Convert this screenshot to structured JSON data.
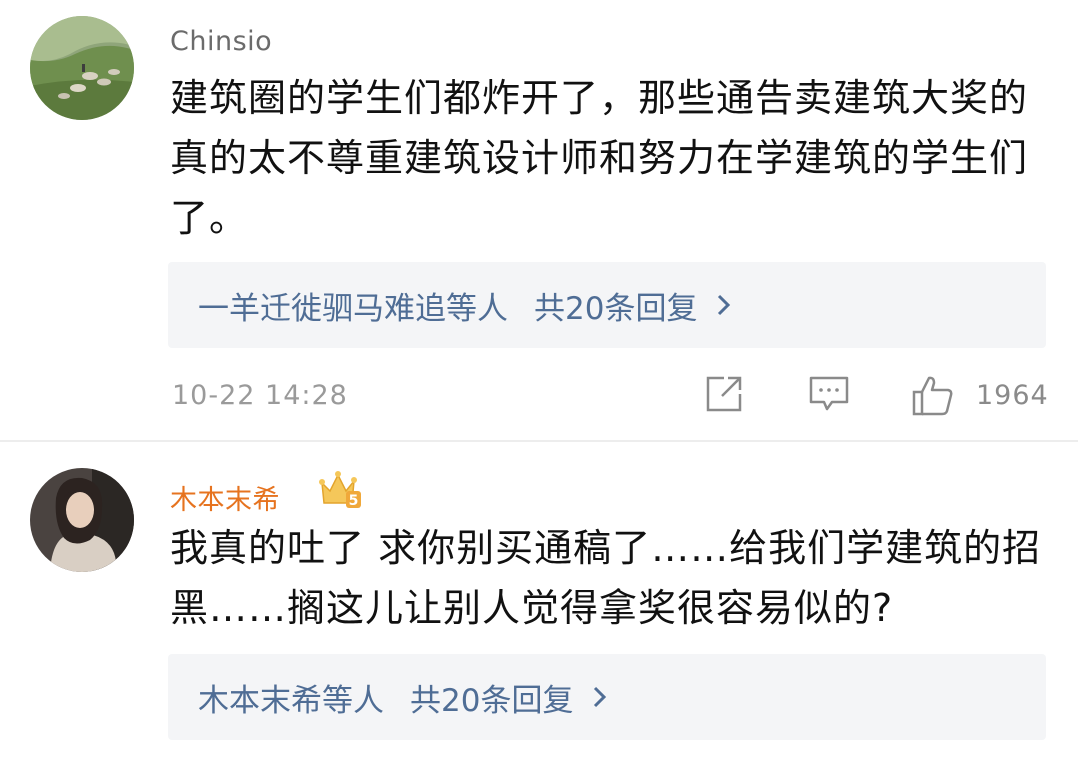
{
  "comments": [
    {
      "username": "Chinsio",
      "text": "建筑圈的学生们都炸开了，那些通告卖建筑大奖的真的太不尊重建筑设计师和努力在学建筑的学生们了。",
      "replies_label": "一羊迁徙驷马难追等人",
      "replies_count": "共20条回复",
      "timestamp": "10-22 14:28",
      "likes": "1964",
      "avatar": "landscape-avatar"
    },
    {
      "username": "木本末希",
      "text": "我真的吐了 求你别买通稿了……给我们学建筑的招黑……搁这儿让别人觉得拿奖很容易似的?",
      "replies_label": "木本末希等人",
      "replies_count": "共20条回复",
      "avatar": "person-avatar",
      "badge": "crown-icon",
      "badge_level": "5"
    }
  ],
  "icons": {
    "share": "share-icon",
    "comment": "comment-icon",
    "like": "thumbs-up-icon",
    "chevron": "chevron-right-icon"
  },
  "colors": {
    "link": "#4f6d95",
    "vip_name": "#e6731f",
    "reply_bg": "#f4f5f7",
    "meta": "#9a9a9a"
  }
}
